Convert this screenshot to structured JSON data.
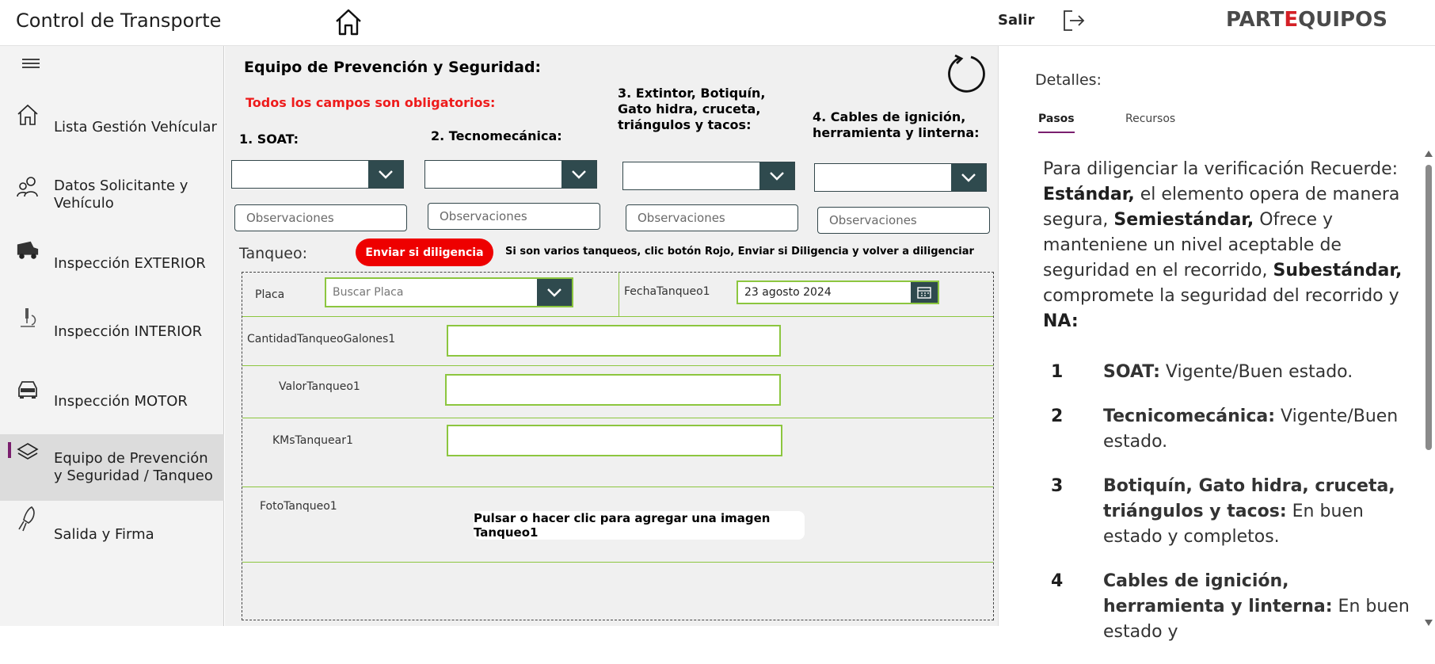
{
  "header": {
    "app_title": "Control de Transporte",
    "home_icon": "home-icon",
    "logout_label": "Salir",
    "logout_icon": "logout-icon",
    "logo_text_left": "PART",
    "logo_text_mid": "E",
    "logo_text_right": "QUIPOS",
    "logo_accent": "#d42026"
  },
  "sidebar": {
    "menu_icon": "hamburger-icon",
    "items": [
      {
        "label": "Lista  Gestión Vehícular",
        "icon": "home-icon"
      },
      {
        "label": "Datos Solicitante y Vehículo",
        "icon": "people-icon"
      },
      {
        "label": "Inspección EXTERIOR",
        "icon": "truck-icon"
      },
      {
        "label": "Inspección INTERIOR",
        "icon": "microscope-icon"
      },
      {
        "label": "Inspección MOTOR",
        "icon": "car-icon"
      },
      {
        "label": "Equipo de Prevención y Seguridad / Tanqueo",
        "icon": "layers-icon",
        "active": true
      },
      {
        "label": "Salida y Firma",
        "icon": "rocket-icon"
      }
    ],
    "active_color": "#7a1f6e"
  },
  "form": {
    "title": "Equipo de Prevención y Seguridad:",
    "required_note": "Todos los campos son obligatorios:",
    "required_color": "#ee1c1c",
    "questions": [
      {
        "label": "1. SOAT:",
        "selected": "",
        "obs_placeholder": "Observaciones"
      },
      {
        "label": "2. Tecnomecánica:",
        "selected": "",
        "obs_placeholder": "Observaciones"
      },
      {
        "label": "3. Extintor, Botiquín, Gato hidra, cruceta, triángulos y tacos:",
        "selected": "",
        "obs_placeholder": "Observaciones"
      },
      {
        "label": "4. Cables de ignición, herramienta y linterna:",
        "selected": "",
        "obs_placeholder": "Observaciones"
      }
    ],
    "tanqueo": {
      "section_label": "Tanqueo:",
      "send_button": "Enviar si diligencia",
      "send_color": "#ee0000",
      "hint": "Si son varios tanqueos, clic botón Rojo, Enviar si Diligencia y volver a diligenciar",
      "placa_label": "Placa",
      "placa_placeholder": "Buscar Placa",
      "fecha_label": "FechaTanqueo1",
      "fecha_value": "23 agosto 2024",
      "cantidad_label": "CantidadTanqueoGalones1",
      "cantidad_value": "",
      "valor_label": "ValorTanqueo1",
      "valor_value": "",
      "kms_label": "KMsTanquear1",
      "kms_value": "",
      "foto_label": "FotoTanqueo1",
      "foto_button": "Pulsar o hacer clic para agregar una imagen Tanqueo1",
      "field_border_color": "#8cc63f"
    }
  },
  "details": {
    "title": "Detalles:",
    "tabs": [
      "Pasos",
      "Recursos"
    ],
    "intro_1": "Para diligenciar la verificación Recuerde: ",
    "term_estandar": "Estándar,",
    "intro_2": " el elemento opera de manera segura, ",
    "term_semi": "Semiestándar,",
    "intro_3": " Ofrece y manteniene un nivel aceptable de seguridad en el recorrido, ",
    "term_sub": "Subestándar,",
    "intro_4": " compromete la seguridad del recorrido y ",
    "term_na": "NA:",
    "steps": [
      {
        "num": "1",
        "term": "SOAT:",
        "text": " Vigente/Buen estado."
      },
      {
        "num": "2",
        "term": "Tecnicomecánica:",
        "text": " Vigente/Buen estado."
      },
      {
        "num": "3",
        "term": "Botiquín, Gato hidra, cruceta, triángulos y tacos:",
        "text": " En buen estado y completos."
      },
      {
        "num": "4",
        "term": "Cables de ignición, herramienta y linterna:",
        "text": " En buen estado y"
      }
    ]
  }
}
